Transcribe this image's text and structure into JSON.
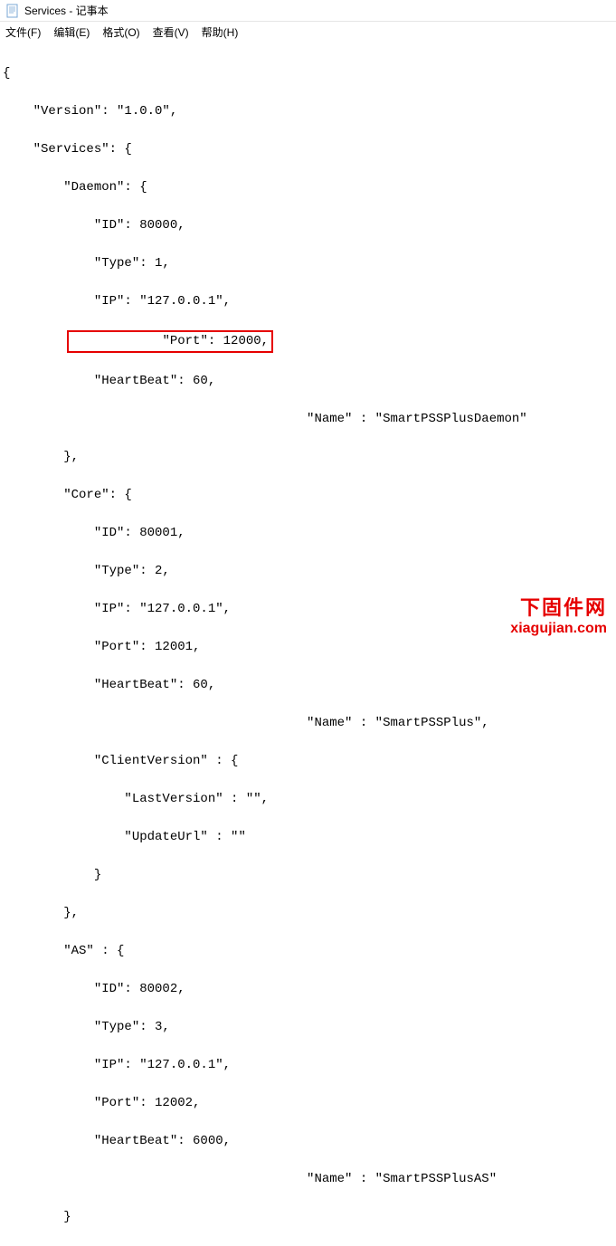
{
  "window": {
    "title": "Services - 记事本"
  },
  "menu": {
    "file": "文件(F)",
    "edit": "编辑(E)",
    "format": "格式(O)",
    "view": "查看(V)",
    "help": "帮助(H)"
  },
  "code": {
    "l1": "{",
    "l2": "    \"Version\": \"1.0.0\",",
    "l3": "    \"Services\": {",
    "l4": "        \"Daemon\": {",
    "l5": "            \"ID\": 80000,",
    "l6": "            \"Type\": 1,",
    "l7": "            \"IP\": \"127.0.0.1\",",
    "l8": "            \"Port\": 12000,",
    "l9": "            \"HeartBeat\": 60,",
    "l10name": "                                        \"Name\" : \"SmartPSSPlusDaemon\"",
    "l11": "        },",
    "l12": "        \"Core\": {",
    "l13": "            \"ID\": 80001,",
    "l14": "            \"Type\": 2,",
    "l15": "            \"IP\": \"127.0.0.1\",",
    "l16": "            \"Port\": 12001,",
    "l17": "            \"HeartBeat\": 60,",
    "l18name": "                                        \"Name\" : \"SmartPSSPlus\",",
    "l19": "            \"ClientVersion\" : {",
    "l20": "                \"LastVersion\" : \"\",",
    "l21": "                \"UpdateUrl\" : \"\"",
    "l22": "            }",
    "l23": "        },",
    "l24": "        \"AS\" : {",
    "l25": "            \"ID\": 80002,",
    "l26": "            \"Type\": 3,",
    "l27": "            \"IP\": \"127.0.0.1\",",
    "l28": "            \"Port\": 12002,",
    "l29": "            \"HeartBeat\": 6000,",
    "l30name": "                                        \"Name\" : \"SmartPSSPlusAS\"",
    "l31": "        }"
  },
  "watermark": {
    "cn": "下固件网",
    "url": "xiagujian.com"
  }
}
